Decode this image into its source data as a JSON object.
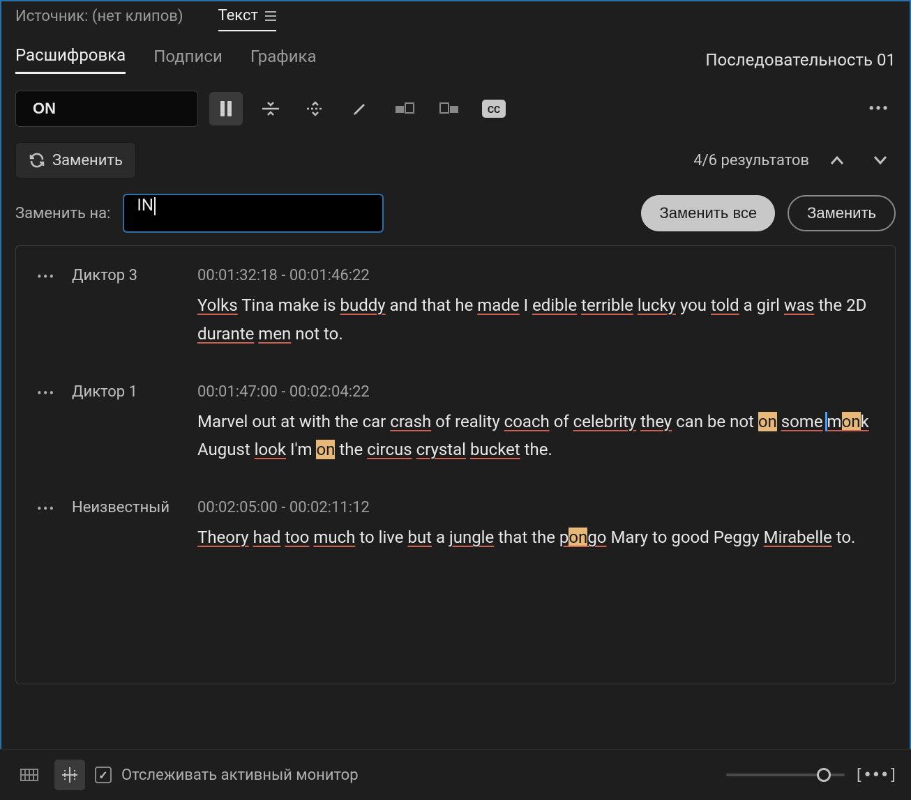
{
  "panel_tabs": {
    "source": "Источник: (нет клипов)",
    "text": "Текст"
  },
  "sub_tabs": {
    "transcript": "Расшифровка",
    "captions": "Подписи",
    "graphics": "Графика"
  },
  "sequence_name": "Последовательность 01",
  "search": {
    "value": "ON"
  },
  "replace_toggle": "Заменить",
  "results": "4/6 результатов",
  "replace_label": "Заменить на:",
  "replace_value": "IN",
  "btn_replace_all": "Заменить все",
  "btn_replace": "Заменить",
  "footer": {
    "track_label": "Отслеживать активный монитор",
    "brackets": "[•••]"
  },
  "segments": [
    {
      "speaker": "Диктор 3",
      "time": "00:01:32:18 - 00:01:46:22",
      "tokens": [
        {
          "t": "Yolks",
          "u": true
        },
        {
          "t": " Tina make is "
        },
        {
          "t": "buddy",
          "u": true
        },
        {
          "t": " and that he "
        },
        {
          "t": "made",
          "u": true
        },
        {
          "t": " I "
        },
        {
          "t": "edible",
          "u": true
        },
        {
          "t": " "
        },
        {
          "t": "terrible",
          "u": true
        },
        {
          "t": " "
        },
        {
          "t": "lucky",
          "u": true
        },
        {
          "t": " you "
        },
        {
          "t": "told",
          "u": true
        },
        {
          "t": " a girl "
        },
        {
          "t": "was",
          "u": true
        },
        {
          "t": " the 2D "
        },
        {
          "t": "durante",
          "u": true
        },
        {
          "t": " "
        },
        {
          "t": "men",
          "u": true
        },
        {
          "t": " not to."
        }
      ]
    },
    {
      "speaker": "Диктор 1",
      "time": "00:01:47:00 - 00:02:04:22",
      "tokens": [
        {
          "t": "Marvel out at with the car "
        },
        {
          "t": "crash",
          "u": true
        },
        {
          "t": " of reality "
        },
        {
          "t": "coach",
          "u": true
        },
        {
          "t": " of "
        },
        {
          "t": "celebrity",
          "u": true
        },
        {
          "t": " "
        },
        {
          "t": "they",
          "u": true
        },
        {
          "t": " can be not "
        },
        {
          "t": "on",
          "hl": true
        },
        {
          "t": " "
        },
        {
          "t": "some",
          "u": true
        },
        {
          "t": " "
        },
        {
          "t": "m",
          "u": true,
          "active": true
        },
        {
          "t": "on",
          "u": true,
          "hl": true
        },
        {
          "t": "k",
          "u": true
        },
        {
          "t": " August "
        },
        {
          "t": "look",
          "u": true
        },
        {
          "t": " I'm "
        },
        {
          "t": "on",
          "hl": true
        },
        {
          "t": " the "
        },
        {
          "t": "circus",
          "u": true
        },
        {
          "t": " "
        },
        {
          "t": "crystal",
          "u": true
        },
        {
          "t": " "
        },
        {
          "t": "bucket",
          "u": true
        },
        {
          "t": " the."
        }
      ]
    },
    {
      "speaker": "Неизвестный",
      "time": "00:02:05:00 - 00:02:11:12",
      "tokens": [
        {
          "t": "Theory",
          "u": true
        },
        {
          "t": " "
        },
        {
          "t": "had",
          "u": true
        },
        {
          "t": " "
        },
        {
          "t": "too",
          "u": true
        },
        {
          "t": " "
        },
        {
          "t": "much",
          "u": true
        },
        {
          "t": " to live "
        },
        {
          "t": "but",
          "u": true
        },
        {
          "t": " a "
        },
        {
          "t": "jungle",
          "u": true
        },
        {
          "t": " that the "
        },
        {
          "t": "p",
          "u": true
        },
        {
          "t": "on",
          "u": true,
          "hl": true
        },
        {
          "t": "go",
          "u": true
        },
        {
          "t": " Mary to good Peggy "
        },
        {
          "t": "Mirabelle",
          "u": true
        },
        {
          "t": " to."
        }
      ]
    }
  ]
}
